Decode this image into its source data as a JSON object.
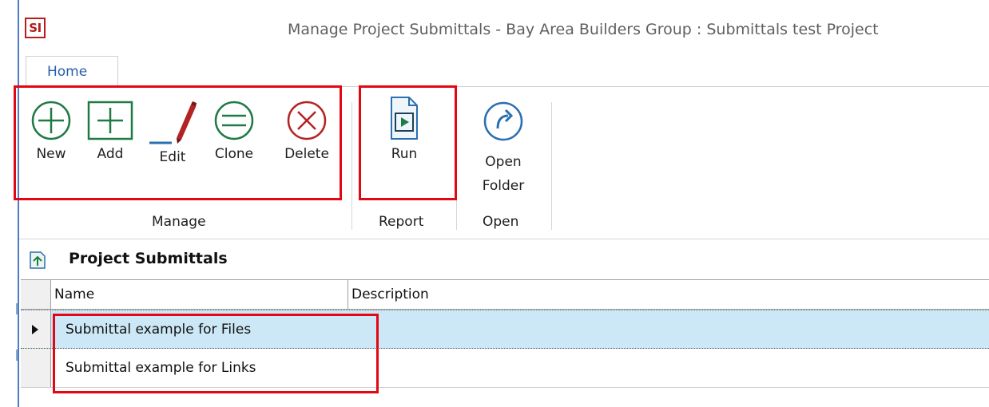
{
  "window": {
    "logo_text": "SI",
    "title": "Manage Project Submittals - Bay Area Builders Group : Submittals test Project"
  },
  "tabs": [
    {
      "label": "Home",
      "active": true
    }
  ],
  "ribbon": {
    "groups": [
      {
        "label": "Manage",
        "buttons": [
          {
            "label": "New",
            "icon": "plus-circle-icon"
          },
          {
            "label": "Add",
            "icon": "plus-square-icon"
          },
          {
            "label": "Edit",
            "icon": "pen-icon"
          },
          {
            "label": "Clone",
            "icon": "equals-circle-icon"
          },
          {
            "label": "Delete",
            "icon": "x-circle-icon"
          }
        ]
      },
      {
        "label": "Report",
        "buttons": [
          {
            "label": "Run",
            "icon": "run-report-icon"
          }
        ]
      },
      {
        "label": "Open",
        "buttons": [
          {
            "label_line1": "Open",
            "label_line2": "Folder",
            "icon": "open-folder-redo-icon"
          }
        ]
      }
    ]
  },
  "section": {
    "title": "Project Submittals",
    "icon": "collapse-up-icon"
  },
  "grid": {
    "columns": [
      "Name",
      "Description"
    ],
    "rows": [
      {
        "name": "Submittal example for Files",
        "description": "",
        "selected": true
      },
      {
        "name": "Submittal example for Links",
        "description": "",
        "selected": false
      }
    ]
  },
  "colors": {
    "accent_blue": "#2a5da8",
    "green_icon": "#1f7a45",
    "red_icon": "#b42323",
    "highlight_red": "#e30613",
    "selected_row": "#cce8f6"
  }
}
